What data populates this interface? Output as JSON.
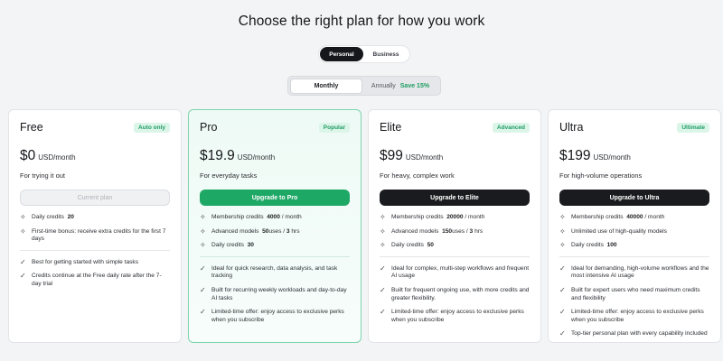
{
  "title": "Choose the right plan for how you work",
  "account_toggle": {
    "personal": "Personal",
    "business": "Business"
  },
  "billing_toggle": {
    "monthly": "Monthly",
    "annually": "Annually",
    "save": "Save 15%"
  },
  "colors": {
    "accent": "#1ea866",
    "badge_bg": "#dcf5e9",
    "dark_button": "#1a1b1f"
  },
  "plans": [
    {
      "name": "Free",
      "badge": "Auto only",
      "price": "$0",
      "unit": "USD/month",
      "tagline": "For trying it out",
      "cta": "Current plan",
      "credits": [
        {
          "icon": "sparkle-icon",
          "label": "Daily credits",
          "value": "20"
        },
        {
          "icon": "sparkle-icon",
          "label": "First-time bonus: receive extra credits for the first 7 days"
        }
      ],
      "benefits": [
        "Best for getting started with simple tasks",
        "Credits continue at the Free daily rate after the 7-day trial"
      ]
    },
    {
      "name": "Pro",
      "badge": "Popular",
      "price": "$19.9",
      "unit": "USD/month",
      "tagline": "For everyday tasks",
      "cta": "Upgrade to Pro",
      "credits": [
        {
          "label": "Membership credits",
          "value": "4000",
          "suffix": "/ month"
        },
        {
          "label": "Advanced models",
          "value": "50",
          "suffix": "uses",
          "value2": "3",
          "suffix2": "hrs"
        },
        {
          "label": "Daily credits",
          "value": "30"
        }
      ],
      "benefits": [
        "Ideal for quick research, data analysis, and task tracking",
        "Built for recurring weekly workloads and day-to-day AI tasks",
        "Limited-time offer: enjoy access to exclusive perks when you subscribe"
      ]
    },
    {
      "name": "Elite",
      "badge": "Advanced",
      "price": "$99",
      "unit": "USD/month",
      "tagline": "For heavy, complex work",
      "cta": "Upgrade to Elite",
      "credits": [
        {
          "label": "Membership credits",
          "value": "20000",
          "suffix": "/ month"
        },
        {
          "label": "Advanced models",
          "value": "150",
          "suffix": "uses",
          "value2": "3",
          "suffix2": "hrs"
        },
        {
          "label": "Daily credits",
          "value": "50"
        }
      ],
      "benefits": [
        "Ideal for complex, multi-step workflows and frequent AI usage",
        "Built for frequent ongoing use, with more credits and greater flexibility.",
        "Limited-time offer: enjoy access to exclusive perks when you subscribe"
      ]
    },
    {
      "name": "Ultra",
      "badge": "Ultimate",
      "price": "$199",
      "unit": "USD/month",
      "tagline": "For high-volume operations",
      "cta": "Upgrade to Ultra",
      "credits": [
        {
          "label": "Membership credits",
          "value": "40000",
          "suffix": "/ month"
        },
        {
          "label": "Unlimited use of high-quality models"
        },
        {
          "label": "Daily credits",
          "value": "100"
        }
      ],
      "benefits": [
        "Ideal for demanding, high-volume workflows and the most intensive AI usage",
        "Built for expert users who need maximum credits and flexibility",
        "Limited-time offer: enjoy access to exclusive perks when you subscribe",
        "Top-tier personal plan with every capability included"
      ]
    }
  ]
}
